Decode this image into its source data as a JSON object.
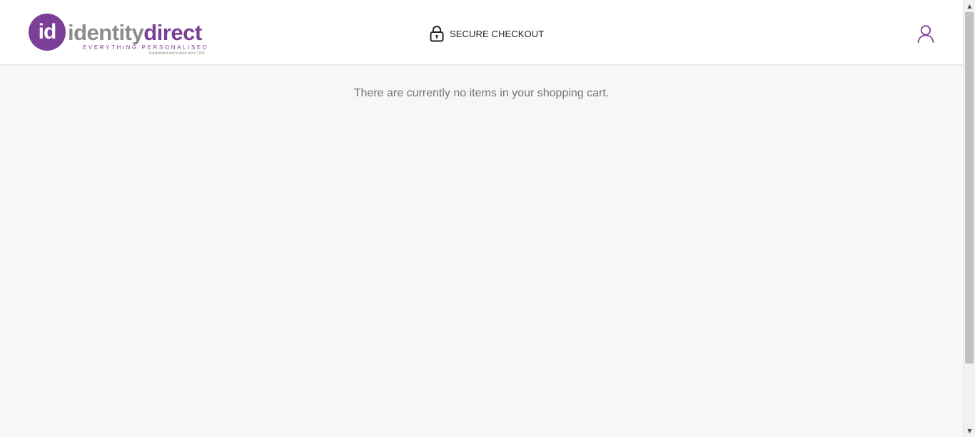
{
  "header": {
    "logo": {
      "badge": "id",
      "word_part1": "identity",
      "word_part2": "direct",
      "tagline": "EVERYTHING PERSONALISED",
      "established": "Established and trusted since 1992."
    },
    "secure_checkout": {
      "icon": "lock-icon",
      "label": "SECURE CHECKOUT"
    },
    "account": {
      "icon": "user-icon"
    }
  },
  "main": {
    "empty_cart_message": "There are currently no items in your shopping cart."
  },
  "colors": {
    "brand_purple": "#7b3f98",
    "brand_grey": "#8c8c8c",
    "page_background": "#f7f7f7",
    "header_background": "#ffffff",
    "message_text": "#757575"
  },
  "scrollbar": {
    "up_icon": "scroll-up-arrow-icon",
    "down_icon": "scroll-down-arrow-icon"
  }
}
